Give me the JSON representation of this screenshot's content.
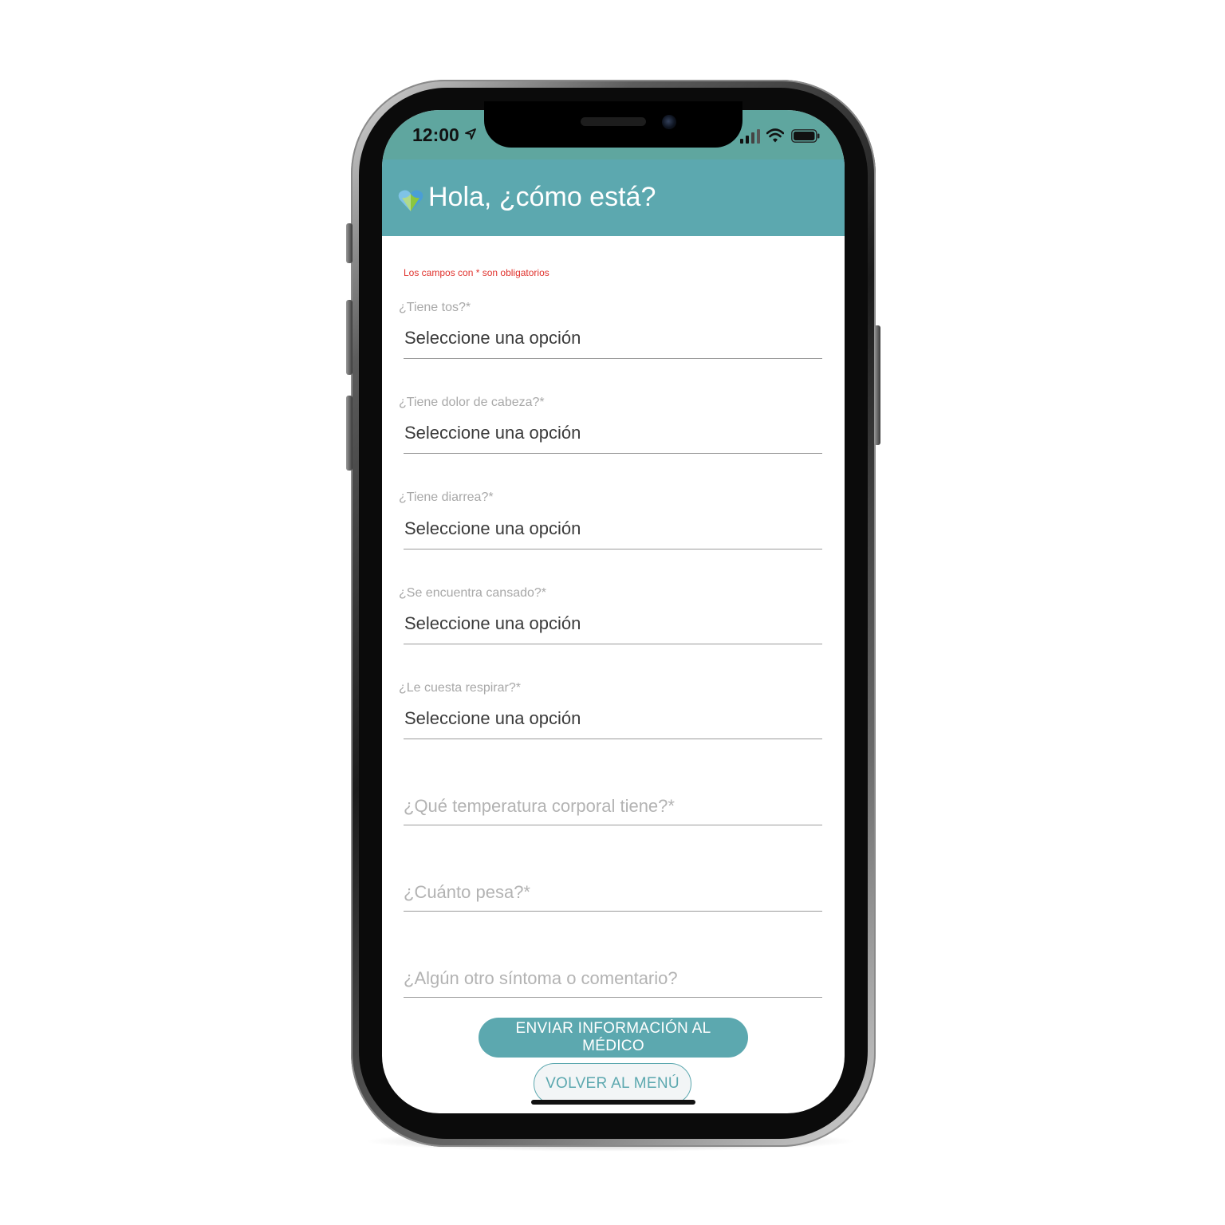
{
  "status_bar": {
    "time": "12:00"
  },
  "header": {
    "title": "Hola, ¿cómo está?"
  },
  "form": {
    "required_note": "Los campos con * son obligatorios",
    "questions": [
      {
        "label": "¿Tiene tos?*",
        "value": "Seleccione una opción"
      },
      {
        "label": "¿Tiene dolor de cabeza?*",
        "value": "Seleccione una opción"
      },
      {
        "label": "¿Tiene diarrea?*",
        "value": "Seleccione una opción"
      },
      {
        "label": "¿Se encuentra cansado?*",
        "value": "Seleccione una opción"
      },
      {
        "label": "¿Le cuesta respirar?*",
        "value": "Seleccione una opción"
      }
    ],
    "inputs": {
      "temperature_placeholder": "¿Qué temperatura corporal tiene?*",
      "weight_placeholder": "¿Cuánto pesa?*",
      "comment_placeholder": "¿Algún otro síntoma o comentario?"
    }
  },
  "buttons": {
    "send_label": "ENVIAR INFORMACIÓN AL MÉDICO",
    "back_label": "VOLVER AL MENÚ"
  },
  "colors": {
    "header": "#5ca8af",
    "status_bar": "#5fa69f",
    "required_note": "#e0322d",
    "primary_button": "#5ca8af"
  }
}
